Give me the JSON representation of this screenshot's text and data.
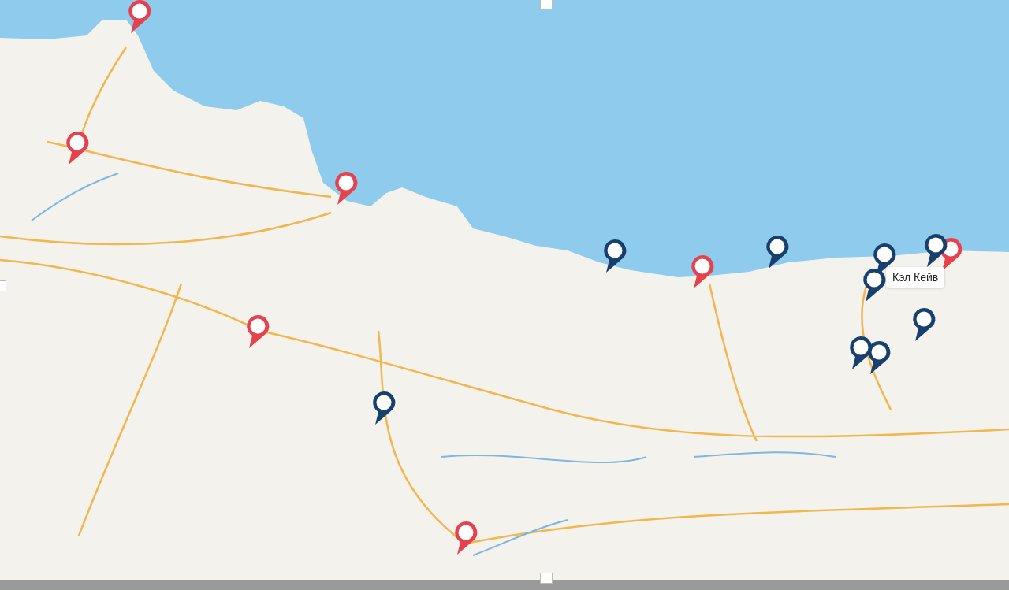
{
  "map": {
    "pins": [
      {
        "color": "#e5424d"
      },
      {
        "color": "#e5424d"
      },
      {
        "color": "#e5424d"
      },
      {
        "color": "#e5424d"
      },
      {
        "color": "#e5424d"
      },
      {
        "color": "#e5424d"
      },
      {
        "color": "#e5424d"
      },
      {
        "color": "#17406e"
      },
      {
        "color": "#17406e"
      },
      {
        "color": "#17406e"
      },
      {
        "color": "#17406e"
      },
      {
        "color": "#17406e"
      },
      {
        "color": "#17406e"
      },
      {
        "color": "#17406e"
      },
      {
        "color": "#17406e"
      },
      {
        "color": "#17406e"
      }
    ],
    "tooltip": {
      "label": "Кэл Кейв"
    }
  }
}
